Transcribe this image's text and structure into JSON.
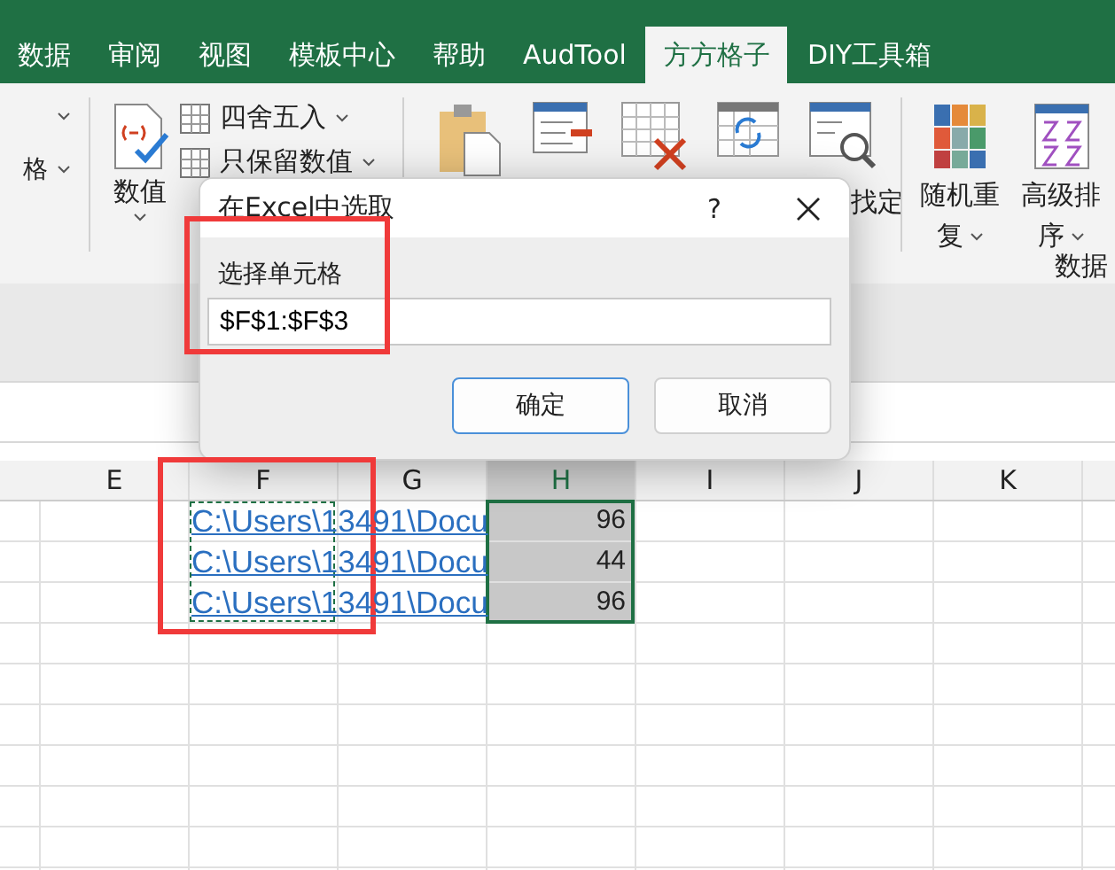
{
  "ribbon_tabs": [
    {
      "label": "数据",
      "selected": false
    },
    {
      "label": "审阅",
      "selected": false
    },
    {
      "label": "视图",
      "selected": false
    },
    {
      "label": "模板中心",
      "selected": false
    },
    {
      "label": "帮助",
      "selected": false
    },
    {
      "label": "AudTool",
      "selected": false
    },
    {
      "label": "方方格子",
      "selected": true
    },
    {
      "label": "DIY工具箱",
      "selected": false
    }
  ],
  "ribbon": {
    "cut_label": "格",
    "number_button": "数值",
    "commands": [
      {
        "label": "四舍五入"
      },
      {
        "label": "只保留数值"
      }
    ],
    "find_label": "找定",
    "sort_buttons": [
      {
        "lines": [
          "随机重",
          "复"
        ]
      },
      {
        "lines": [
          "高级排",
          "序"
        ]
      }
    ],
    "group_label": "数据"
  },
  "dialog": {
    "title": "在Excel中选取",
    "help": "?",
    "field_label": "选择单元格",
    "field_value": "$F$1:$F$3",
    "buttons": [
      "确定",
      "取消"
    ]
  },
  "sheet": {
    "columns": [
      {
        "label": "E",
        "selected": false
      },
      {
        "label": "F",
        "selected": false
      },
      {
        "label": "G",
        "selected": false
      },
      {
        "label": "H",
        "selected": true
      },
      {
        "label": "I",
        "selected": false
      },
      {
        "label": "J",
        "selected": false
      },
      {
        "label": "K",
        "selected": false
      }
    ],
    "rows": [
      {
        "link": "C:\\Users\\13491\\Docu",
        "value": "96"
      },
      {
        "link": "C:\\Users\\13491\\Docu",
        "value": "44"
      },
      {
        "link": "C:\\Users\\13491\\Docu",
        "value": "96"
      }
    ]
  }
}
